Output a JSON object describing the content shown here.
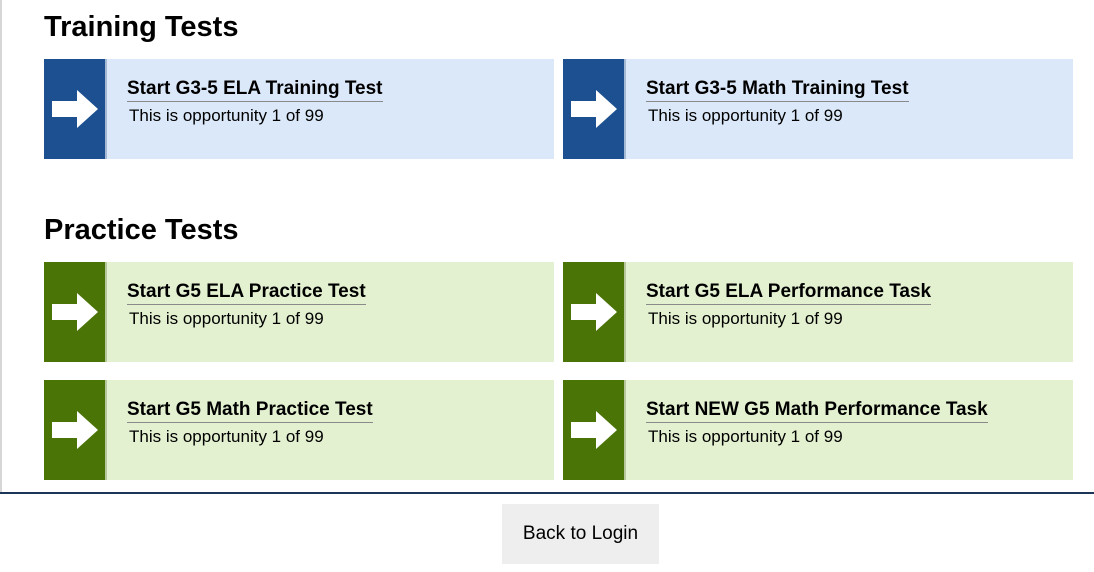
{
  "sections": {
    "training": {
      "heading": "Training Tests",
      "tiles": [
        {
          "title": "Start G3-5 ELA Training Test",
          "subtitle": "This is opportunity 1 of 99",
          "icon": "arrow-right-icon"
        },
        {
          "title": "Start G3-5 Math Training Test",
          "subtitle": "This is opportunity 1 of 99",
          "icon": "arrow-right-icon"
        }
      ]
    },
    "practice": {
      "heading": "Practice Tests",
      "tiles": [
        {
          "title": "Start G5 ELA Practice Test",
          "subtitle": "This is opportunity 1 of 99",
          "icon": "arrow-right-icon"
        },
        {
          "title": "Start G5 ELA Performance Task",
          "subtitle": "This is opportunity 1 of 99",
          "icon": "arrow-right-icon"
        },
        {
          "title": "Start G5 Math Practice Test",
          "subtitle": "This is opportunity 1 of 99",
          "icon": "arrow-right-icon"
        },
        {
          "title": "Start NEW G5 Math Performance Task",
          "subtitle": "This is opportunity 1 of 99",
          "icon": "arrow-right-icon"
        }
      ]
    }
  },
  "footer": {
    "back_label": "Back to Login"
  },
  "colors": {
    "training_accent": "#1d5091",
    "training_bg": "#dbe8f9",
    "practice_accent": "#4b7407",
    "practice_bg": "#e3f1d0"
  }
}
